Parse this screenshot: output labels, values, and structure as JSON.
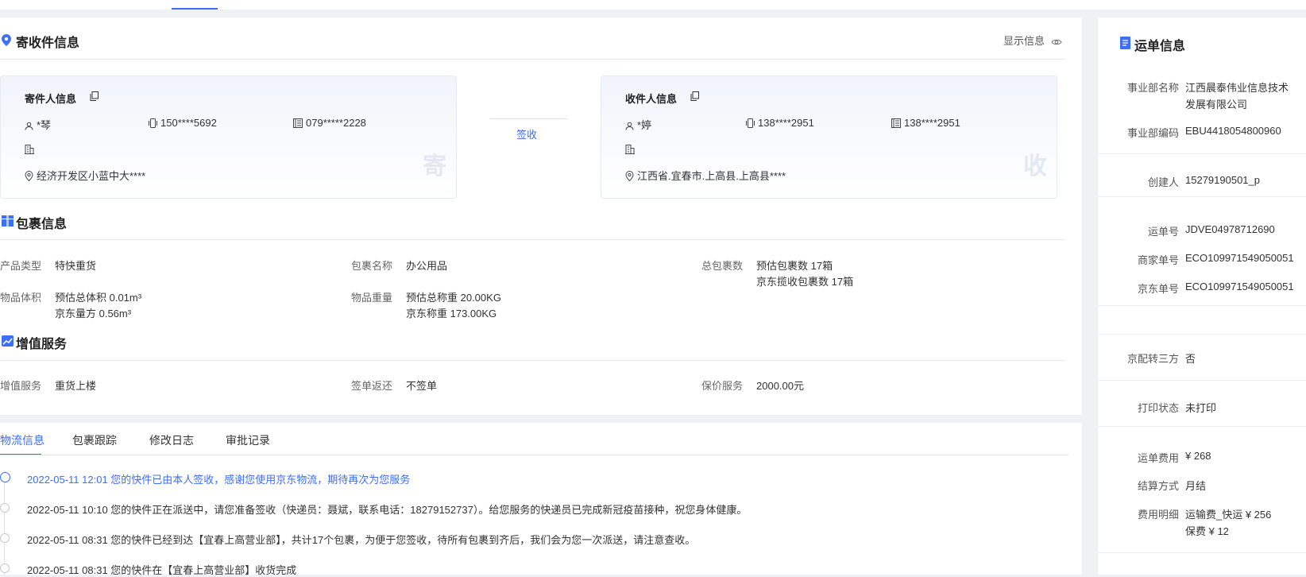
{
  "colors": {
    "accent": "#3d6ef7",
    "panel": "#ffffff",
    "background": "#f0f1f3"
  },
  "address": {
    "title": "寄收件信息",
    "show_info": "显示信息",
    "sender": {
      "title": "寄件人信息",
      "name": "*琴",
      "mobile": "150****5692",
      "phone": "079*****2228",
      "address": "经济开发区小蓝中大****",
      "badge": "寄"
    },
    "status": "签收",
    "receiver": {
      "title": "收件人信息",
      "name": "*婷",
      "mobile": "138****2951",
      "phone": "138****2951",
      "address": "江西省.宜春市.上高县.上高县****",
      "badge": "收"
    }
  },
  "package": {
    "title": "包裹信息",
    "product_type_label": "产品类型",
    "product_type": "特快重货",
    "name_label": "包裹名称",
    "name": "办公用品",
    "count_label": "总包裹数",
    "count_est": "预估包裹数 17箱",
    "count_jd": "京东揽收包裹数 17箱",
    "volume_label": "物品体积",
    "volume_est": "预估总体积 0.01m³",
    "volume_jd": "京东量方 0.56m³",
    "weight_label": "物品重量",
    "weight_est": "预估总称重 20.00KG",
    "weight_jd": "京东称重 173.00KG"
  },
  "value_added": {
    "title": "增值服务",
    "service_label": "增值服务",
    "service": "重货上楼",
    "return_label": "签单返还",
    "return": "不签单",
    "insure_label": "保价服务",
    "insure": "2000.00元"
  },
  "tabs": [
    "物流信息",
    "包裹跟踪",
    "修改日志",
    "审批记录"
  ],
  "timeline": [
    "2022-05-11 12:01 您的快件已由本人签收，感谢您使用京东物流，期待再次为您服务",
    "2022-05-11 10:10 您的快件正在派送中，请您准备签收（快递员：聂斌，联系电话：18279152737）。给您服务的快递员已完成新冠疫苗接种，祝您身体健康。",
    "2022-05-11 08:31 您的快件已经到达【宜春上高营业部】，共计17个包裹，为便于您签收，待所有包裹到齐后，我们会为您一次派送，请注意查收。",
    "2022-05-11 08:31 您的快件在【宜春上高营业部】收货完成"
  ],
  "waybill": {
    "title": "运单信息",
    "rows": [
      {
        "label": "事业部名称",
        "value": "江西晨泰伟业信息技术",
        "value2": "发展有限公司"
      },
      {
        "label": "事业部编码",
        "value": "EBU4418054800960"
      },
      {
        "label": "创建人",
        "value": "15279190501_p"
      },
      {
        "label": "运单号",
        "value": "JDVE04978712690"
      },
      {
        "label": "商家单号",
        "value": "ECO109971549050051"
      },
      {
        "label": "京东单号",
        "value": "ECO109971549050051"
      },
      {
        "label": "京配转三方",
        "value": "否"
      },
      {
        "label": "打印状态",
        "value": "未打印"
      },
      {
        "label": "运单费用",
        "value": "¥ 268"
      },
      {
        "label": "结算方式",
        "value": "月结"
      },
      {
        "label": "费用明细",
        "value": "运输费_快运 ¥ 256",
        "value2": "保费 ¥ 12"
      }
    ]
  }
}
